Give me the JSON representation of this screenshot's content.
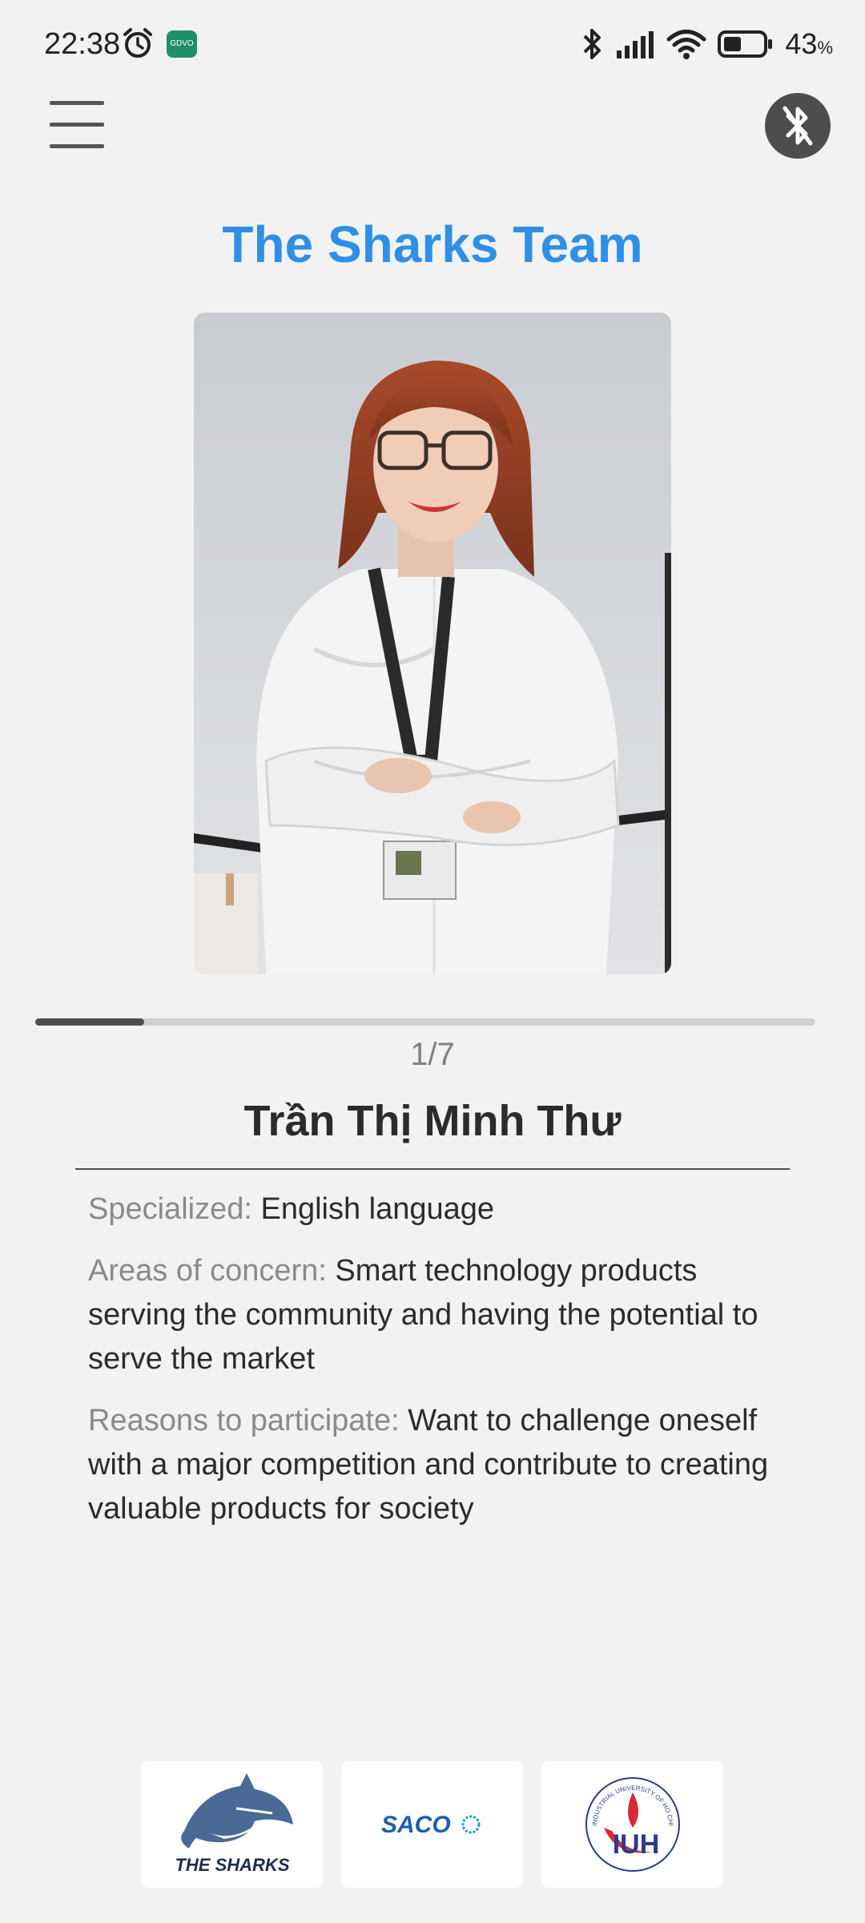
{
  "status_bar": {
    "time": "22:38",
    "app_badge": "GDVO",
    "battery": "43",
    "battery_unit": "%",
    "icons": [
      "alarm-icon",
      "app-icon",
      "bluetooth-icon",
      "signal-icon",
      "wifi-icon",
      "battery-icon"
    ]
  },
  "header": {
    "title": "The Sharks Team"
  },
  "member": {
    "position": "1/7",
    "progress": 0.14,
    "name": "Trần Thị Minh Thư",
    "specialized_label": "Specialized: ",
    "specialized": "English language",
    "areas_label": "Areas of concern: ",
    "areas": "Smart technology products serving the community and having the potential to serve the market",
    "reasons_label": "Reasons to participate: ",
    "reasons": "Want to challenge oneself with a major competition and contribute to creating valuable products for society"
  },
  "logos": {
    "sharks_text": "THE SHARKS",
    "saco_text": "SACO",
    "iuh_ring_text": "INDUSTRIAL UNIVERSITY OF HO CHI MINH CITY",
    "iuh_text": "IUH"
  },
  "colors": {
    "title": "#2e8fe6",
    "background": "#f2f2f2",
    "progress": "#4e4e4e"
  }
}
